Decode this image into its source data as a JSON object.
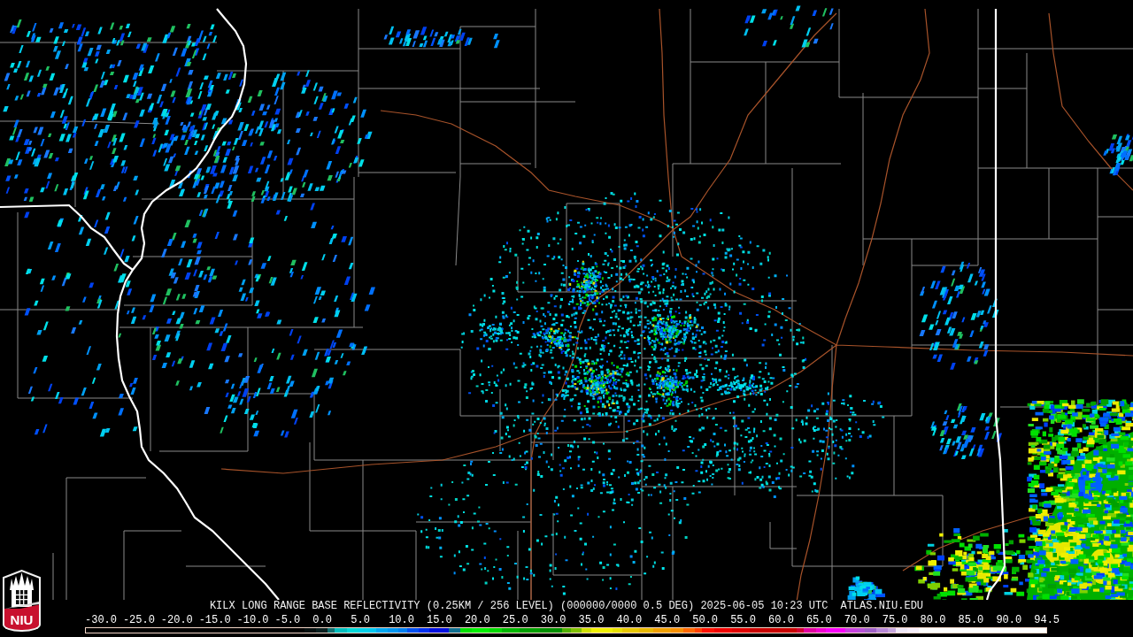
{
  "caption": {
    "title": "KILX LONG RANGE BASE REFLECTIVITY (0.25KM / 256 LEVEL) (000000/0000 0.5 DEG) 2025-06-05 10:23 UTC",
    "source": "ATLAS.NIU.EDU"
  },
  "logo": {
    "text": "NIU"
  },
  "color_scale": {
    "labels": [
      "-30.0",
      "-25.0",
      "-20.0",
      "-15.0",
      "-10.0",
      "-5.0",
      "0.0",
      "5.0",
      "10.0",
      "15.0",
      "20.0",
      "25.0",
      "30.0",
      "35.0",
      "40.0",
      "45.0",
      "50.0",
      "55.0",
      "60.0",
      "65.0",
      "70.0",
      "75.0",
      "80.0",
      "85.0",
      "90.0",
      "94.5"
    ]
  }
}
